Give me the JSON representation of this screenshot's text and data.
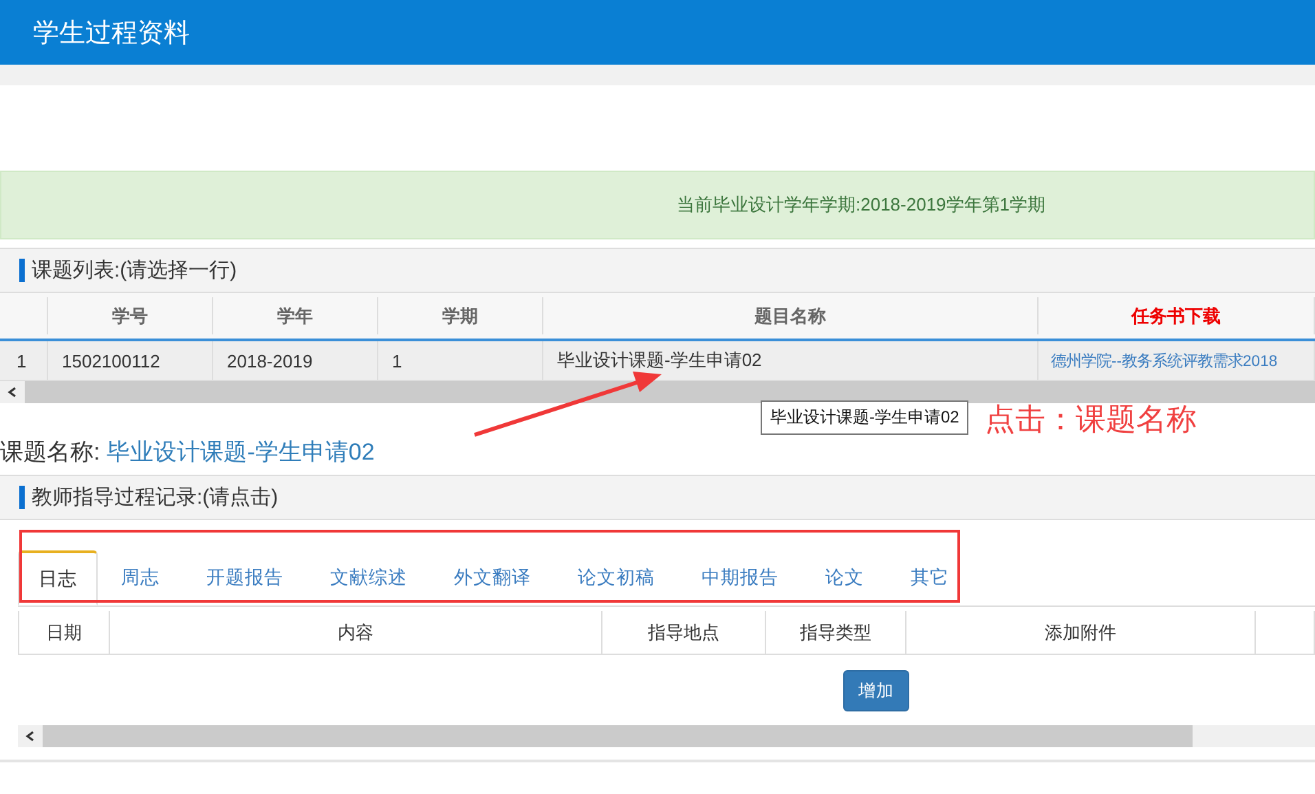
{
  "header": {
    "title": "学生过程资料"
  },
  "alert": {
    "text": "当前毕业设计学年学期:2018-2019学年第1学期"
  },
  "topic_panel": {
    "title": "课题列表:(请选择一行)",
    "columns": [
      {
        "label": "学号",
        "highlight": false
      },
      {
        "label": "学年",
        "highlight": false
      },
      {
        "label": "学期",
        "highlight": false
      },
      {
        "label": "题目名称",
        "highlight": false
      },
      {
        "label": "任务书下载",
        "highlight": true
      }
    ],
    "rows": [
      {
        "index": "1",
        "student_id": "1502100112",
        "year": "2018-2019",
        "term": "1",
        "topic": "毕业设计课题-学生申请02",
        "download": "德州学院--教务系统评教需求2018",
        "selected": true
      }
    ]
  },
  "tooltip": "毕业设计课题-学生申请02",
  "topic_name": {
    "label": "课题名称:",
    "value": "毕业设计课题-学生申请02"
  },
  "guidance_panel": {
    "title": "教师指导过程记录:(请点击)",
    "tabs": [
      {
        "label": "日志",
        "selected": true
      },
      {
        "label": "周志",
        "selected": false
      },
      {
        "label": "开题报告",
        "selected": false
      },
      {
        "label": "文献综述",
        "selected": false
      },
      {
        "label": "外文翻译",
        "selected": false
      },
      {
        "label": "论文初稿",
        "selected": false
      },
      {
        "label": "中期报告",
        "selected": false
      },
      {
        "label": "论文",
        "selected": false
      },
      {
        "label": "其它",
        "selected": false
      }
    ],
    "columns": [
      "日期",
      "内容",
      "指导地点",
      "指导类型",
      "添加附件"
    ],
    "add_button": "增加"
  },
  "annotation": {
    "text": "点击：课题名称"
  }
}
